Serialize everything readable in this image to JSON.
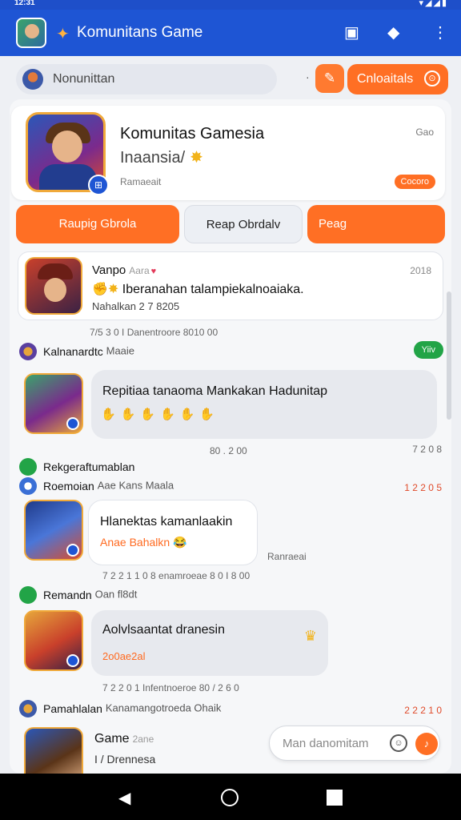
{
  "status_bar": {
    "time": "12:31",
    "icons": "▾◢◢▮"
  },
  "app_bar": {
    "title": "Komunitans Game",
    "camera_icon": "camera-icon",
    "box_icon": "box-icon",
    "more_icon": "more-vert-icon"
  },
  "search": {
    "label": "Nonunittan",
    "dot": "·",
    "edit_icon": "✎",
    "cta_label": "Cnloaitals",
    "cta_icon": "⊙"
  },
  "hero": {
    "title": "Komunitas Gamesia",
    "subtitle": "Inaansia/",
    "subtitle_icon": "✸",
    "meta": "Ramaeait",
    "corner": "Gao",
    "badge": "Cocoro",
    "badge_icon": "⊞"
  },
  "tabs": [
    {
      "label": "Raupig Gbrola"
    },
    {
      "label": "Reap Obrdalv"
    },
    {
      "label": "Peag"
    }
  ],
  "post": {
    "name": "Vanpo",
    "name_sub": "Aara",
    "heart": "♥",
    "time": "2018",
    "emojis": "✊✸",
    "text": "Iberanahan talampiekalnoaiaka.",
    "tag": "Nahalkan 2 7 8205"
  },
  "timestamps": {
    "t1": "7/5 3 0 I Danentroore 8010 00",
    "t2_left": "80 . 2 00",
    "t2_right": "7 2 0 8",
    "t3": "7 2 2 1 1 0 8 enamroeae 8 0 I 8 00",
    "t3_side": "Ranraeai",
    "t4": "7 2 2 0 1 Infentnoeroe 80 / 2 6 0"
  },
  "messages": [
    {
      "user": "Kalnanardtc",
      "user_sub": "Maaie",
      "online": "Yiiv",
      "text": "Repitiaa tanaoma Mankakan Hadunitap",
      "emojis": "✋✋✋✋✋✋"
    },
    {
      "user": "Rekgeraftumablan"
    },
    {
      "user": "Roemoian",
      "user_sub": "Aae Kans Maala",
      "count": "1 2 2 0 5",
      "text": "Hlanektas kamanlaakin",
      "sub": "Anae Bahalkn 😂"
    },
    {
      "user": "Remandn",
      "user_sub": "Oan fl8dt",
      "text": "Aolvlsaantat dranesin",
      "sub": "2o0ae2al"
    },
    {
      "user": "Pamahlalan",
      "user_sub": "Kanamangotroeda Ohaik",
      "count": "2 2 2 1 0",
      "name": "Game",
      "name_sub": "2ane",
      "sub": "I / Drennesa"
    }
  ],
  "message_input": {
    "placeholder": "Man danomitam"
  },
  "colors": {
    "primary": "#1e55d4",
    "accent": "#ff6f24",
    "online": "#22a447"
  }
}
